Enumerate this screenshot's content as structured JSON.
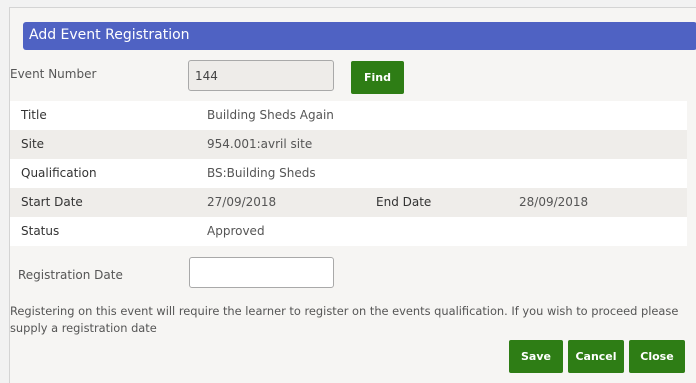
{
  "dialog": {
    "title": "Add Event Registration"
  },
  "event_number": {
    "label": "Event Number",
    "value": "144",
    "find_label": "Find"
  },
  "details": {
    "title_label": "Title",
    "title_value": "Building Sheds Again",
    "site_label": "Site",
    "site_value": "954.001:avril site",
    "qualification_label": "Qualification",
    "qualification_value": "BS:Building Sheds",
    "start_date_label": "Start Date",
    "start_date_value": "27/09/2018",
    "end_date_label": "End Date",
    "end_date_value": "28/09/2018",
    "status_label": "Status",
    "status_value": "Approved"
  },
  "registration_date": {
    "label": "Registration Date",
    "value": ""
  },
  "info_text": "Registering on this event will require the learner to register on the events qualification. If you wish to proceed please supply a registration date",
  "buttons": {
    "save": "Save",
    "cancel": "Cancel",
    "close": "Close"
  },
  "colors": {
    "title_bar": "#4f62c3",
    "button": "#2e7d15"
  }
}
